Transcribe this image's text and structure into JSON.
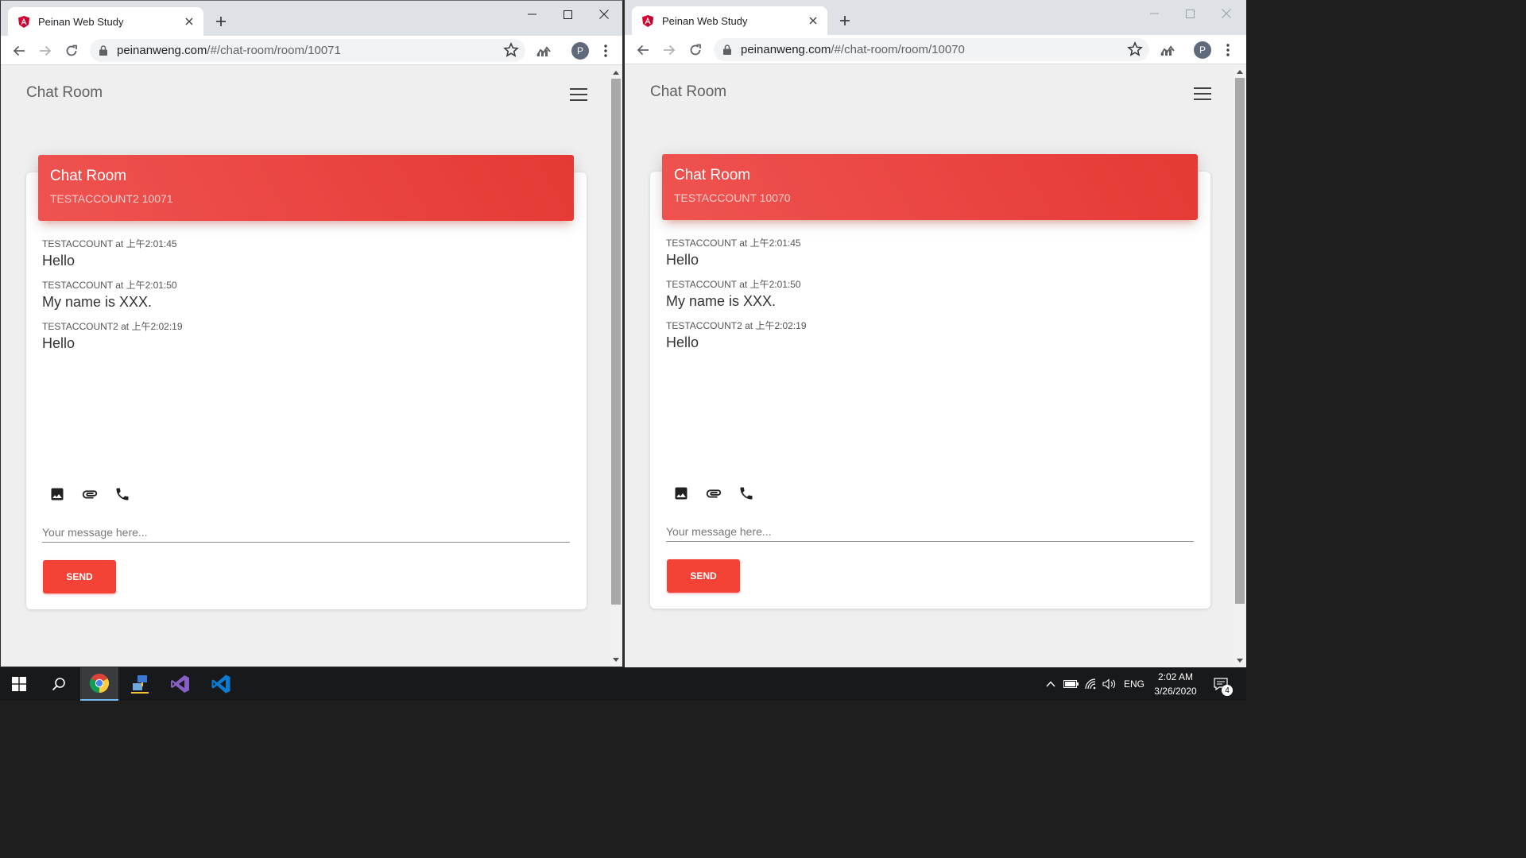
{
  "colors": {
    "accent_red": "#f44336",
    "header_gradient_start": "#ef5350",
    "header_gradient_end": "#e53935",
    "page_background": "#efefef",
    "taskbar": "#18191b"
  },
  "windows": [
    {
      "tab_title": "Peinan Web Study",
      "url_host": "peinanweng.com",
      "url_path": "/#/chat-room/room/10071",
      "profile_initial": "P",
      "app_title": "Chat Room",
      "card": {
        "title": "Chat Room",
        "subtitle": "TESTACCOUNT2 10071"
      },
      "messages": [
        {
          "meta": "TESTACCOUNT at 上午2:01:45",
          "text": "Hello"
        },
        {
          "meta": "TESTACCOUNT at 上午2:01:50",
          "text": "My name is XXX."
        },
        {
          "meta": "TESTACCOUNT2 at 上午2:02:19",
          "text": "Hello"
        }
      ],
      "input_placeholder": "Your message here...",
      "send_label": "SEND"
    },
    {
      "tab_title": "Peinan Web Study",
      "url_host": "peinanweng.com",
      "url_path": "/#/chat-room/room/10070",
      "profile_initial": "P",
      "app_title": "Chat Room",
      "card": {
        "title": "Chat Room",
        "subtitle": "TESTACCOUNT 10070"
      },
      "messages": [
        {
          "meta": "TESTACCOUNT at 上午2:01:45",
          "text": "Hello"
        },
        {
          "meta": "TESTACCOUNT at 上午2:01:50",
          "text": "My name is XXX."
        },
        {
          "meta": "TESTACCOUNT2 at 上午2:02:19",
          "text": "Hello"
        }
      ],
      "input_placeholder": "Your message here...",
      "send_label": "SEND"
    }
  ],
  "taskbar": {
    "pinned_apps": [
      "start-icon",
      "search-icon",
      "chrome-icon",
      "network-app-icon",
      "visual-studio-icon",
      "vscode-icon"
    ],
    "tray": {
      "language": "ENG",
      "time": "2:02 AM",
      "date": "3/26/2020",
      "notification_count": "4"
    }
  }
}
